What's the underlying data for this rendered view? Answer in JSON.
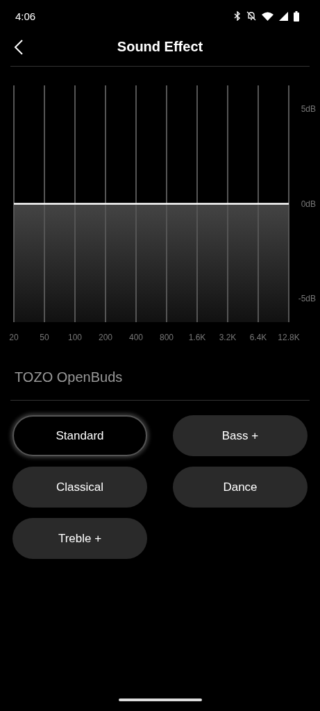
{
  "status_bar": {
    "time": "4:06"
  },
  "header": {
    "title": "Sound Effect"
  },
  "equalizer": {
    "chart_data": {
      "type": "line",
      "categories": [
        "20",
        "50",
        "100",
        "200",
        "400",
        "800",
        "1.6K",
        "3.2K",
        "6.4K",
        "12.8K"
      ],
      "grid": true,
      "series": [
        {
          "color": "#ffffff",
          "values": [
            0,
            0,
            0,
            0,
            0,
            0,
            0,
            0,
            0,
            0
          ]
        }
      ],
      "ylim": [
        -6.25,
        6.25
      ],
      "yticks": [
        {
          "value": 5,
          "label": "5dB"
        },
        {
          "value": 0,
          "label": "0dB"
        },
        {
          "value": -5,
          "label": "-5dB"
        }
      ]
    }
  },
  "device": {
    "name": "TOZO OpenBuds"
  },
  "presets": [
    {
      "label": "Standard",
      "selected": true
    },
    {
      "label": "Bass +",
      "selected": false
    },
    {
      "label": "Classical",
      "selected": false
    },
    {
      "label": "Dance",
      "selected": false
    },
    {
      "label": "Treble +",
      "selected": false
    }
  ]
}
